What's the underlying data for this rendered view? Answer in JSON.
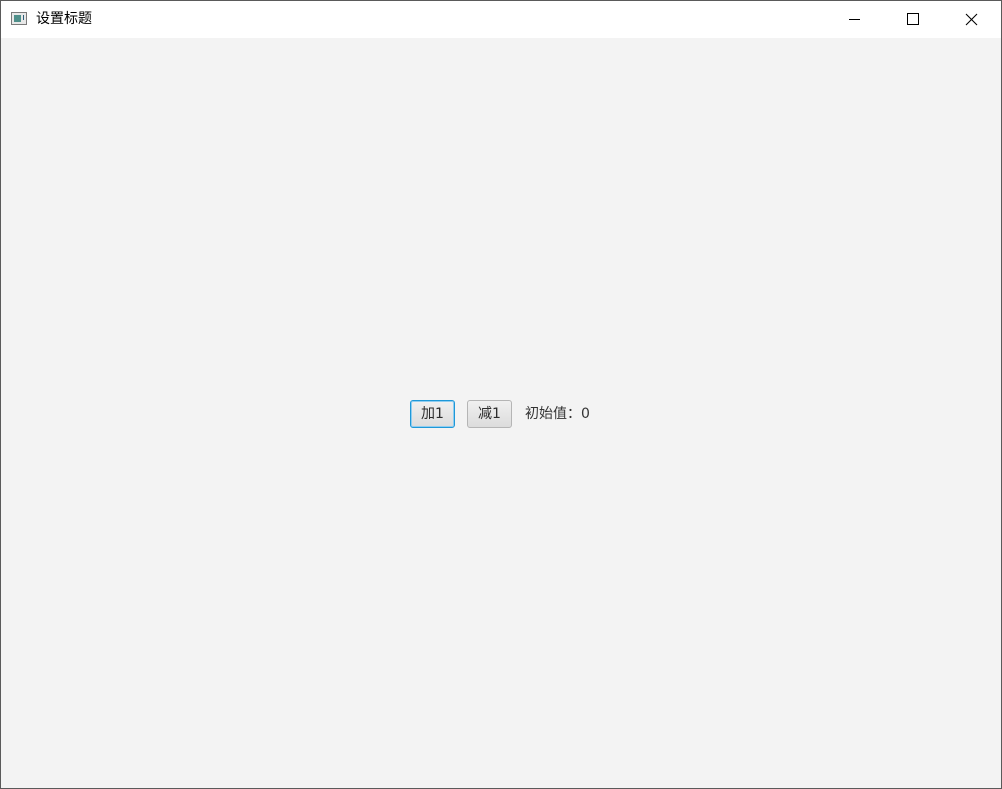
{
  "window": {
    "title": "设置标题"
  },
  "title_bar": {
    "icons": {
      "app": "app-window-icon",
      "minimize": "minimize-icon",
      "maximize": "maximize-icon",
      "close": "close-icon"
    }
  },
  "main": {
    "add_button_label": "加1",
    "subtract_button_label": "减1",
    "value_label": "初始值：0"
  },
  "colors": {
    "focus_border": "#1e98d8",
    "content_background": "#f3f3f3",
    "titlebar_background": "#ffffff"
  }
}
